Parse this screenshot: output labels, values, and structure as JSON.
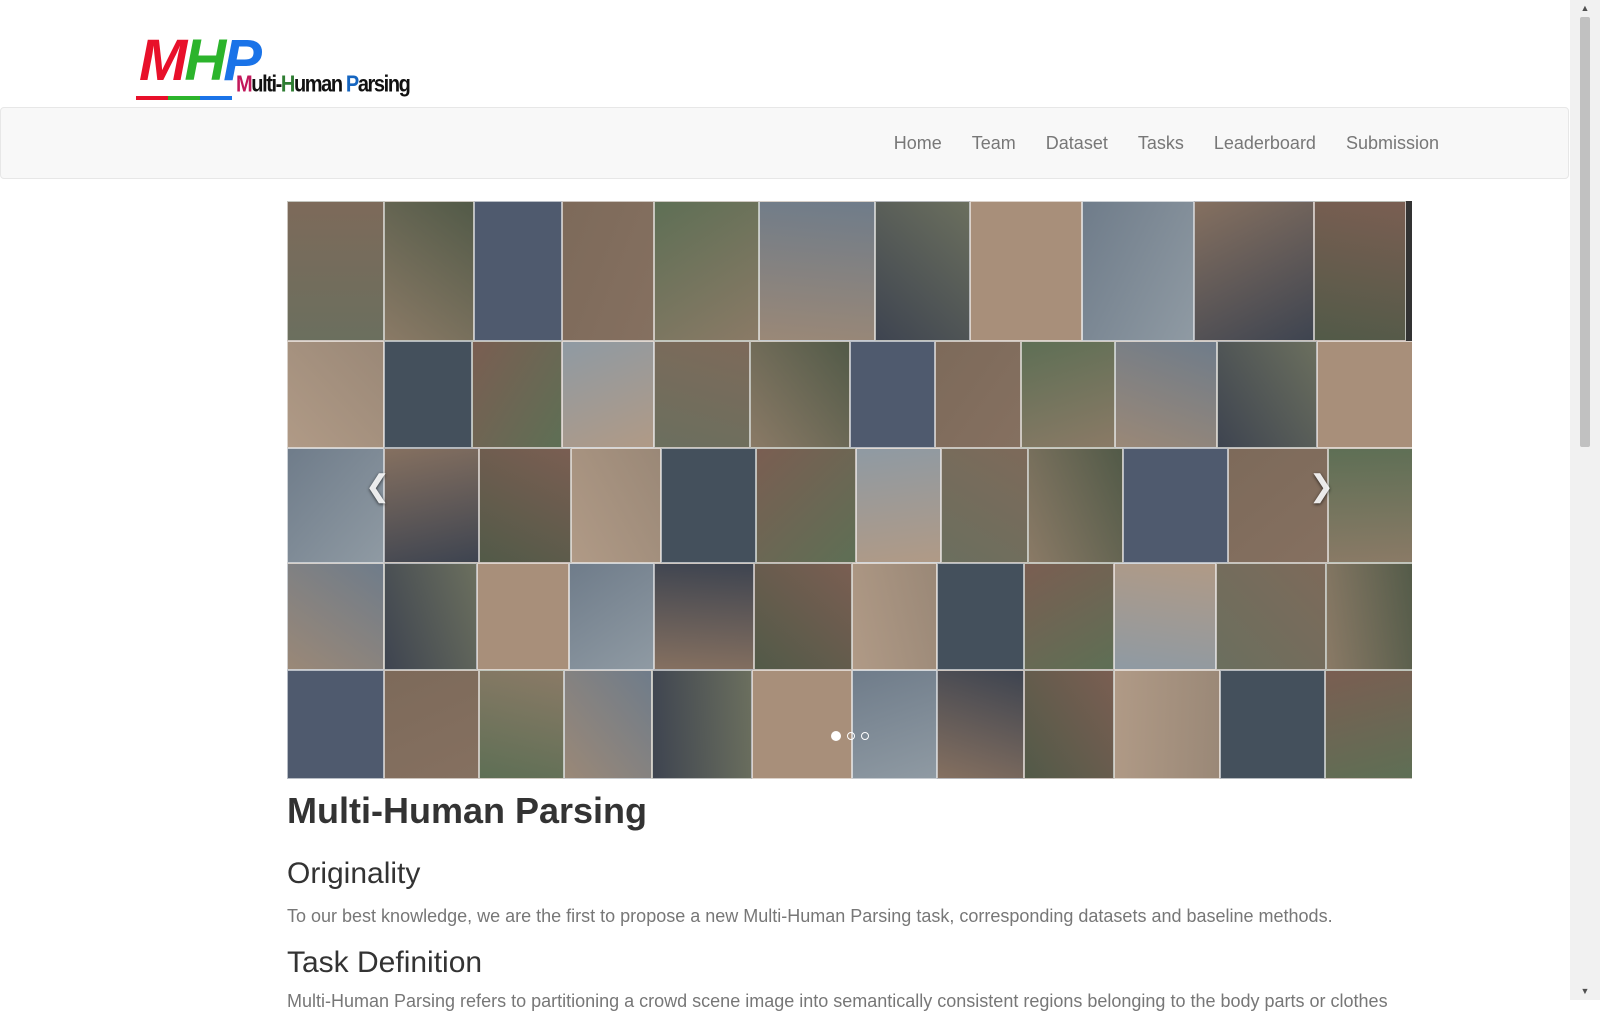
{
  "logo": {
    "mhp_m": "M",
    "mhp_h": "H",
    "mhp_p": "P",
    "sub_m": "M",
    "sub_ulti": "ulti-",
    "sub_h": "H",
    "sub_uman": "uman ",
    "sub_p": "P",
    "sub_arsing": "arsing",
    "colors": {
      "m": "#e8102a",
      "h": "#2cb42c",
      "p": "#1a73e8"
    }
  },
  "nav": {
    "items": [
      {
        "label": "Home"
      },
      {
        "label": "Team"
      },
      {
        "label": "Dataset"
      },
      {
        "label": "Tasks"
      },
      {
        "label": "Leaderboard"
      },
      {
        "label": "Submission"
      }
    ]
  },
  "carousel": {
    "prev_icon": "chevron-left-icon",
    "next_icon": "chevron-right-icon",
    "prev_glyph": "❮",
    "next_glyph": "❯",
    "slide_count": 3,
    "active_slide": 1
  },
  "content": {
    "title": "Multi-Human Parsing",
    "sections": [
      {
        "heading": "Originality",
        "body": "To our best knowledge, we are the first to propose a new Multi-Human Parsing task, corresponding datasets and baseline methods."
      },
      {
        "heading": "Task Definition",
        "body": "Multi-Human Parsing refers to partitioning a crowd scene image into semantically consistent regions belonging to the body parts or clothes"
      }
    ]
  }
}
